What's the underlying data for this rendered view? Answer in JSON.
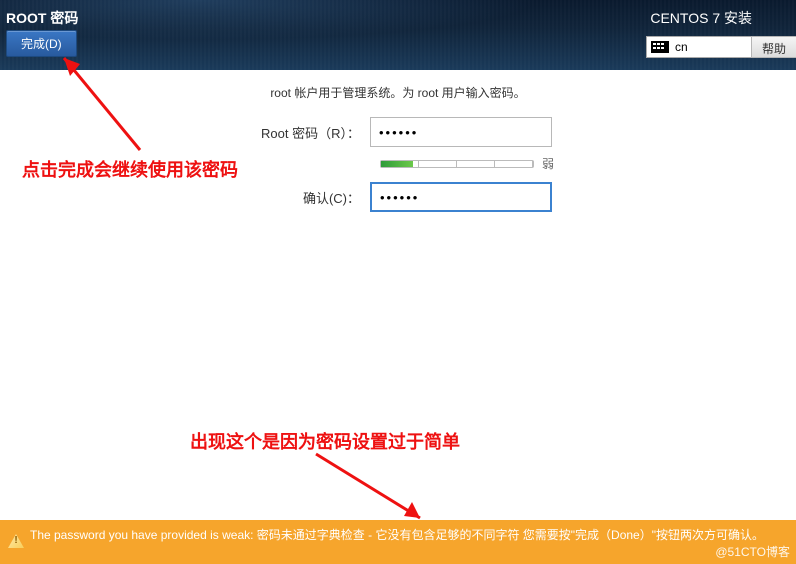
{
  "header": {
    "title": "ROOT 密码",
    "installer_title": "CENTOS 7 安装",
    "done_button": "完成(D)",
    "help_button": "帮助",
    "keyboard_layout": "cn"
  },
  "form": {
    "description": "root 帐户用于管理系统。为 root 用户输入密码。",
    "password_label": "Root 密码（R）：",
    "password_value": "••••••",
    "confirm_label": "确认(C)：",
    "confirm_value": "••••••",
    "strength_label": "弱"
  },
  "annotations": {
    "note1": "点击完成会继续使用该密码",
    "note2": "出现这个是因为密码设置过于简单"
  },
  "warning": {
    "message": "The password you have provided is weak: 密码未通过字典检查 - 它没有包含足够的不同字符 您需要按\"完成（Done）\"按钮两次方可确认。"
  },
  "watermark": "@51CTO博客"
}
